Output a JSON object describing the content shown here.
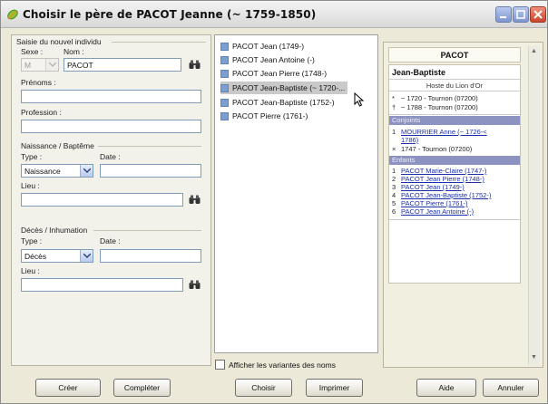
{
  "window": {
    "title": "Choisir le père de PACOT Jeanne (~ 1759-1850)",
    "title_icon": "leaf-icon",
    "controls": [
      "minimize-icon",
      "maximize-icon",
      "close-icon"
    ]
  },
  "form": {
    "group_title": "Saisie du nouvel individu",
    "sexe_label": "Sexe :",
    "sexe_value": "M",
    "nom_label": "Nom :",
    "nom_value": "PACOT",
    "prenoms_label": "Prénoms :",
    "prenoms_value": "",
    "profession_label": "Profession :",
    "profession_value": "",
    "naissance": {
      "title": "Naissance / Baptême",
      "type_label": "Type :",
      "type_value": "Naissance",
      "date_label": "Date :",
      "date_value": "",
      "lieu_label": "Lieu :",
      "lieu_value": ""
    },
    "deces": {
      "title": "Décès / Inhumation",
      "type_label": "Type :",
      "type_value": "Décès",
      "date_label": "Date :",
      "date_value": "",
      "lieu_label": "Lieu :",
      "lieu_value": ""
    }
  },
  "candidates": {
    "items": [
      "PACOT Jean (1749-)",
      "PACOT Jean Antoine (-)",
      "PACOT Jean Pierre (1748-)",
      "PACOT Jean-Baptiste (~ 1720-...",
      "PACOT Jean-Baptiste (1752-)",
      "PACOT Pierre (1761-)"
    ],
    "selected_index": 3,
    "variants_checkbox_label": "Afficher les variantes des noms",
    "variants_checked": false
  },
  "details": {
    "surname": "PACOT",
    "given_name": "Jean-Baptiste",
    "occupation": "Hoste du Lion d'Or",
    "birth": "~ 1720 - Tournon (07200)",
    "death": "~ 1788 - Tournon (07200)",
    "spouses_header": "Conjoints",
    "spouse": {
      "num": "1",
      "name_line1": "MOURRIER Anne (~ 1726-<",
      "name_line2": "1786)",
      "marriage": "1747 - Tournon (07200)"
    },
    "children_header": "Enfants",
    "children": [
      {
        "num": "1",
        "name": "PACOT Marie-Claire (1747-)"
      },
      {
        "num": "2",
        "name": "PACOT Jean Pierre (1748-)"
      },
      {
        "num": "3",
        "name": "PACOT Jean (1749-)"
      },
      {
        "num": "4",
        "name": "PACOT Jean-Baptiste (1752-)"
      },
      {
        "num": "5",
        "name": "PACOT Pierre (1761-)"
      },
      {
        "num": "6",
        "name": "PACOT Jean Antoine (-)"
      }
    ]
  },
  "buttons": {
    "creer": "Créer",
    "completer": "Compléter",
    "choisir": "Choisir",
    "imprimer": "Imprimer",
    "aide": "Aide",
    "annuler": "Annuler"
  },
  "colors": {
    "selection_bg": "#c9c9c9",
    "link": "#1b2fa8",
    "section_bar": "#8c93c1"
  }
}
